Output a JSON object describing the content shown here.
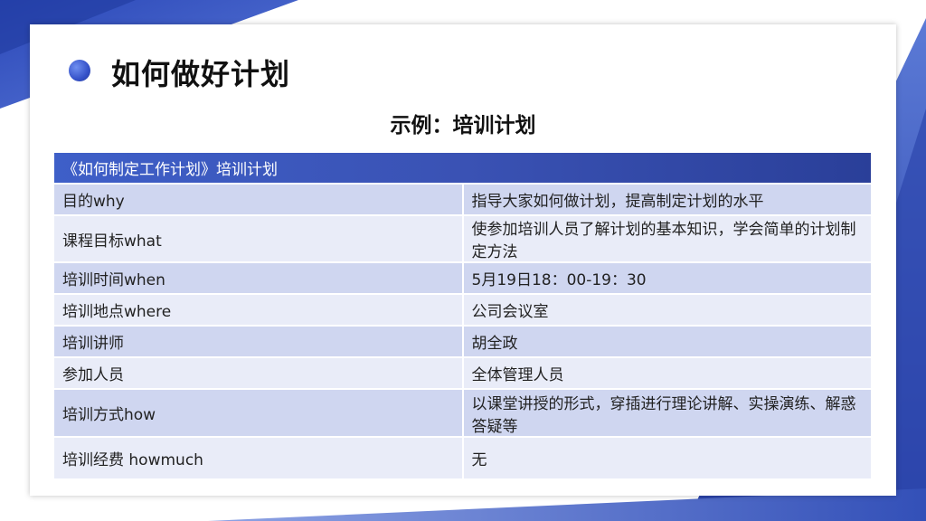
{
  "slide": {
    "title": "如何做好计划",
    "subtitle": "示例：培训计划"
  },
  "table": {
    "header": "《如何制定工作计划》培训计划",
    "rows": [
      {
        "key": "目的why",
        "value": "指导大家如何做计划，提高制定计划的水平"
      },
      {
        "key": "课程目标what",
        "value": "使参加培训人员了解计划的基本知识，学会简单的计划制定方法"
      },
      {
        "key": "培训时间when",
        "value": "5月19日18：00-19：30"
      },
      {
        "key": "培训地点where",
        "value": "公司会议室"
      },
      {
        "key": "培训讲师",
        "value": "胡全政"
      },
      {
        "key": "参加人员",
        "value": "全体管理人员"
      },
      {
        "key": "培训方式how",
        "value": "以课堂讲授的形式，穿插进行理论讲解、实操演练、解惑答疑等"
      },
      {
        "key": "培训经费 howmuch",
        "value": "无"
      }
    ]
  },
  "colors": {
    "accent": "#3a52b4",
    "row_dark": "#cfd6f0",
    "row_light": "#e9ecf8"
  }
}
